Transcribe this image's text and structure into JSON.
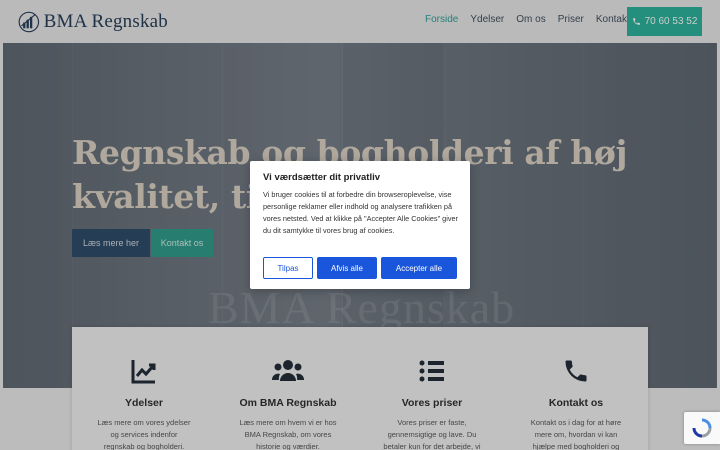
{
  "header": {
    "logo_text": "BMA Regnskab",
    "nav": [
      "Forside",
      "Ydelser",
      "Om os",
      "Priser",
      "Kontakt os"
    ],
    "active_nav": "Forside",
    "phone": "70 60 53 52",
    "accent_color": "#2bb39b"
  },
  "hero": {
    "title": "Regnskab og bogholderi af høj kvalitet, til",
    "watermark": "BMA Regnskab",
    "primary_button": "Læs mere her",
    "secondary_button": "Kontakt os"
  },
  "features": [
    {
      "icon": "chart-icon",
      "title": "Ydelser",
      "desc": "Læs mere om vores ydelser og services indenfor regnskab og bogholderi."
    },
    {
      "icon": "users-icon",
      "title": "Om BMA Regnskab",
      "desc": "Læs mere om hvem vi er hos BMA Regnskab, om vores historie og værdier."
    },
    {
      "icon": "list-icon",
      "title": "Vores priser",
      "desc": "Vores priser er faste, gennemsigtige og lave. Du betaler kun for det arbejde, vi"
    },
    {
      "icon": "phone-icon",
      "title": "Kontakt os",
      "desc": "Kontakt os i dag for at høre mere om, hvordan vi kan hjælpe med bogholderi og"
    }
  ],
  "cookie_dialog": {
    "title": "Vi værdsætter dit privatliv",
    "text": "Vi bruger cookies til at forbedre din browseroplevelse, vise personlige reklamer eller indhold og analysere trafikken på vores netsted. Ved at klikke på \"Accepter Alle Cookies\" giver du dit samtykke til vores brug af cookies.",
    "customize_label": "Tilpas",
    "reject_label": "Afvis alle",
    "accept_label": "Accepter alle",
    "button_color": "#1a56db"
  }
}
